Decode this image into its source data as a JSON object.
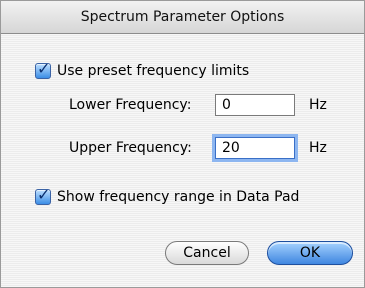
{
  "window": {
    "title": "Spectrum Parameter Options"
  },
  "options": {
    "use_preset": {
      "label": "Use preset frequency limits",
      "checked": true
    },
    "show_range": {
      "label": "Show frequency range in Data Pad",
      "checked": true
    }
  },
  "frequency": {
    "lower": {
      "label": "Lower Frequency:",
      "value": "0",
      "unit": "Hz"
    },
    "upper": {
      "label": "Upper Frequency:",
      "value": "20",
      "unit": "Hz"
    }
  },
  "buttons": {
    "cancel": "Cancel",
    "ok": "OK"
  },
  "colors": {
    "accent": "#3f86e0",
    "focus_ring": "#8db6f0"
  },
  "icons": {
    "checkbox_checked": "checkbox-checked-icon"
  }
}
